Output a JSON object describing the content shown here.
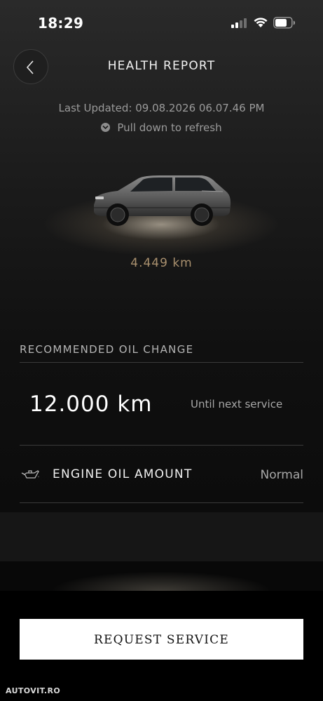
{
  "status_bar": {
    "time": "18:29"
  },
  "header": {
    "title": "HEALTH REPORT"
  },
  "refresh": {
    "last_updated": "Last Updated: 09.08.2026 06.07.46 PM",
    "hint": "Pull down to refresh"
  },
  "vehicle": {
    "odometer": "4.449 km"
  },
  "oil": {
    "section_title": "RECOMMENDED OIL CHANGE",
    "distance": "12.000 km",
    "caption": "Until next service",
    "engine_oil_label": "ENGINE OIL AMOUNT",
    "engine_oil_value": "Normal"
  },
  "actions": {
    "request_service": "REQUEST SERVICE"
  },
  "watermark": "AUTOVIT.RO",
  "colors": {
    "accent_odometer": "#a9906e",
    "button_background": "#ffffff"
  }
}
